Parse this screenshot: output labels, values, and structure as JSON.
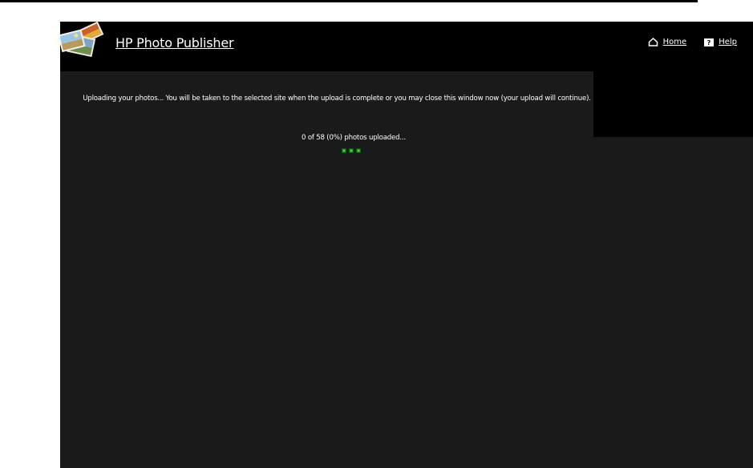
{
  "header": {
    "title": "HP Photo Publisher",
    "nav": {
      "home_label": "Home",
      "help_label": "Help"
    }
  },
  "main": {
    "message": "Uploading your photos... You will be taken to the selected site when the upload is complete or you may close this window now (your upload will continue).",
    "progress_text": "0 of 58 (0%) photos uploaded...",
    "progress": {
      "uploaded": 0,
      "total": 58,
      "percent": 0
    }
  },
  "colors": {
    "background": "#1a1a1a",
    "header": "#000000",
    "text": "#ffffff",
    "spinner": "#1fa01f"
  },
  "icons": [
    "photos-logo-icon",
    "home-icon",
    "help-icon",
    "loading-spinner"
  ]
}
